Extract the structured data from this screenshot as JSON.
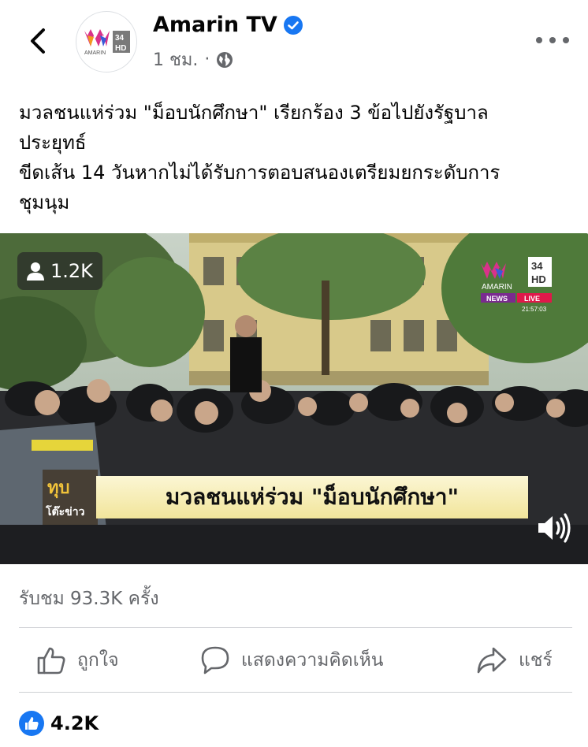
{
  "header": {
    "back_icon": "chevron-left-icon",
    "avatar_logo_text": "AMARIN",
    "avatar_badge_top": "34",
    "avatar_badge_bottom": "HD",
    "page_name": "Amarin TV",
    "verified_icon": "verified-badge-icon",
    "time": "1 ชม.",
    "separator": "·",
    "privacy_icon": "globe-icon",
    "more_icon": "more-horizontal-icon"
  },
  "post": {
    "caption_lines": [
      "มวลชนแห่ร่วม \"ม็อบนักศึกษา\" เรียกร้อง 3 ข้อไปยังรัฐบาล",
      "ประยุทธ์",
      "ขีดเส้น 14 วันหากไม่ได้รับการตอบสนองเตรียมยกระดับการ",
      "ชุมนุม"
    ]
  },
  "video": {
    "live_viewers": "1.2K",
    "viewer_icon": "person-icon",
    "channel_logo_number": "34",
    "channel_logo_hd": "HD",
    "channel_logo_name": "AMARIN",
    "channel_news": "NEWS",
    "channel_live": "LIVE",
    "timestamp": "21:57:03",
    "show_tag_line1": "ทุบ",
    "show_tag_line2": "โต๊ะข่าว",
    "lower_third": "มวลชนแห่ร่วม \"ม็อบนักศึกษา\"",
    "sound_icon": "speaker-volume-icon",
    "colors": {
      "lower_third_bg": "#f2e59b",
      "live_red": "#e0184a",
      "news_purple": "#7a2b8f"
    }
  },
  "stats": {
    "views": "รับชม 93.3K ครั้ง",
    "reaction_count": "4.2K",
    "reaction_icon": "like-reaction-icon"
  },
  "actions": {
    "like_label": "ถูกใจ",
    "comment_label": "แสดงความคิดเห็น",
    "share_label": "แชร์",
    "like_icon": "thumbs-up-icon",
    "comment_icon": "comment-bubble-icon",
    "share_icon": "share-arrow-icon"
  },
  "colors": {
    "accent": "#1877f2",
    "text_secondary": "#65676b",
    "divider": "#ced0d4"
  }
}
